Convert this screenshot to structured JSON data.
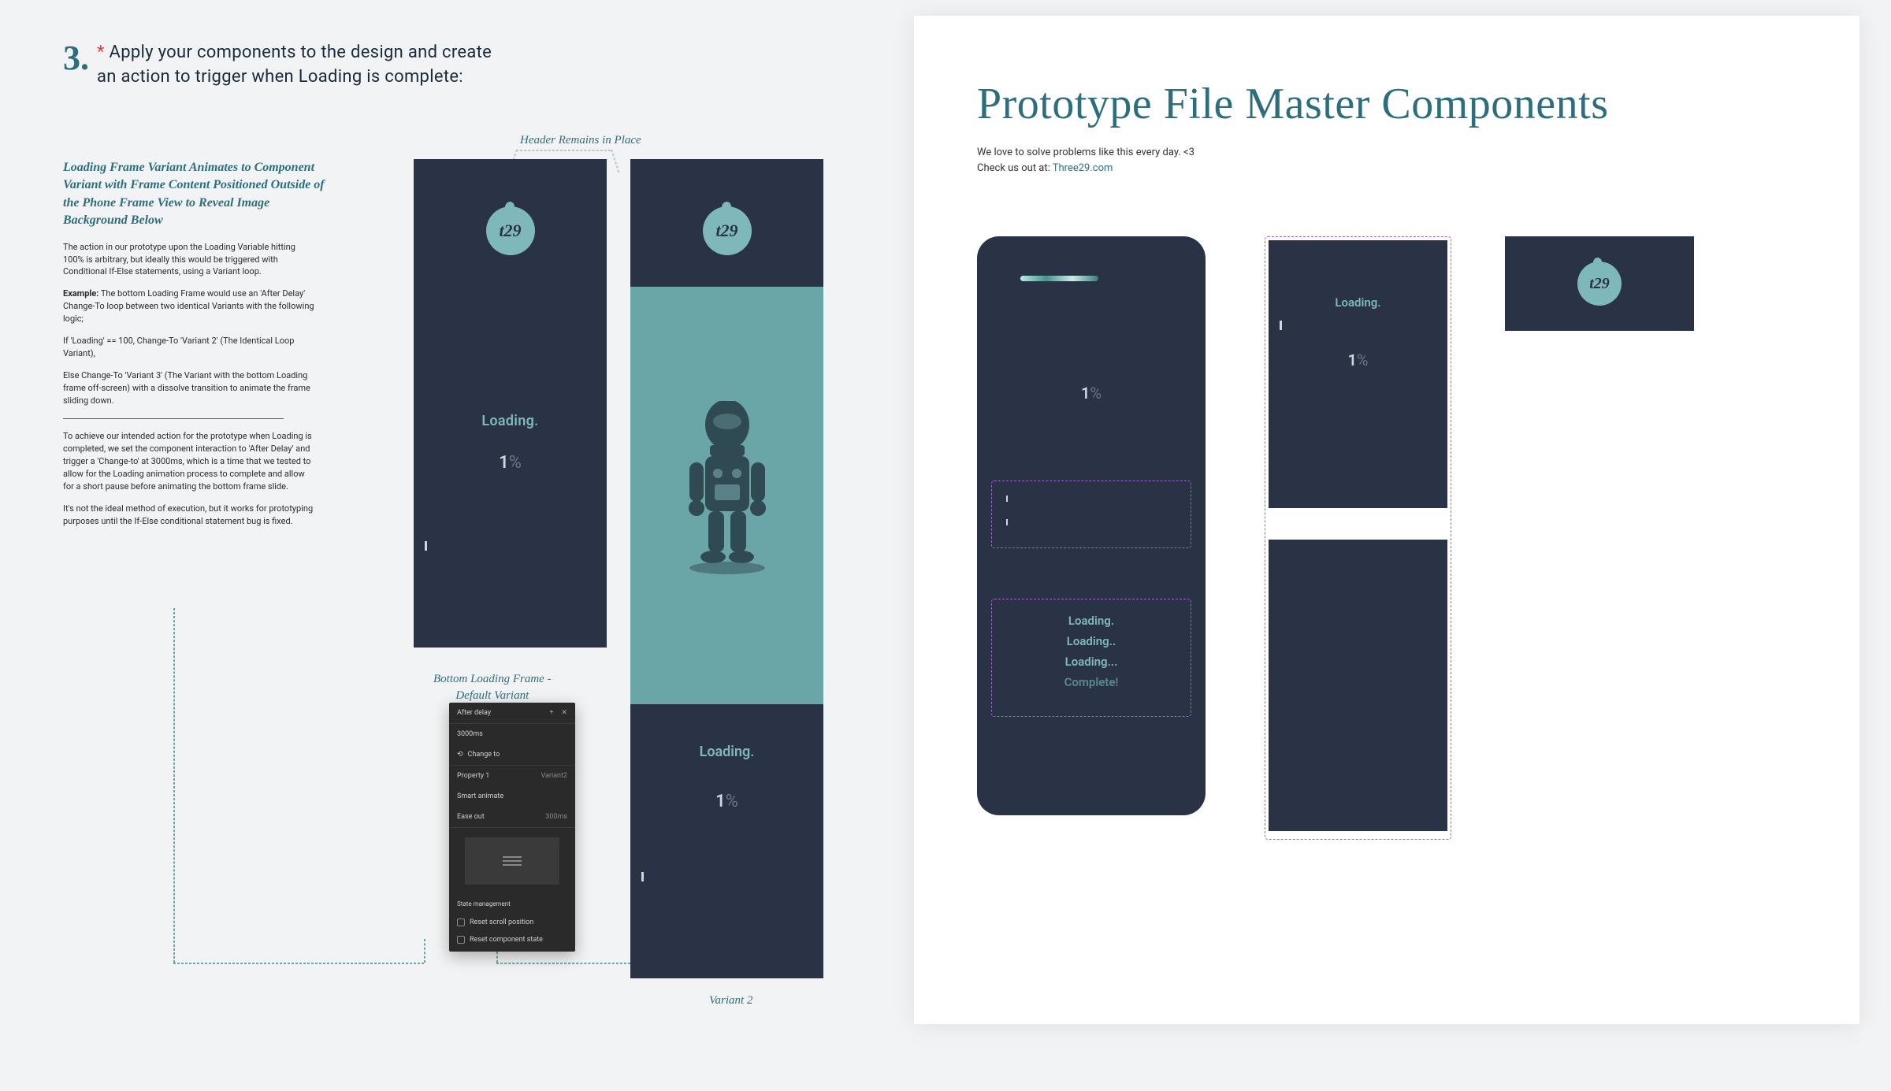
{
  "left": {
    "step_number": "3.",
    "asterisk": "*",
    "step_text_line1": "Apply your components to the design and create",
    "step_text_line2": "an action to trigger when Loading is complete:",
    "anno_title": "Loading Frame Variant Animates to Component Variant with Frame Content Positioned Outside of the Phone Frame View to Reveal Image Background Below",
    "anno_p1": "The action in our prototype upon the Loading Variable hitting 100% is arbitrary, but ideally this would be triggered with Conditional If-Else statements, using a Variant loop.",
    "anno_p2_label": "Example:",
    "anno_p2_rest": " The bottom Loading Frame would use an 'After Delay' Change-To loop between two identical Variants with the following logic;",
    "anno_p3": "If 'Loading' == 100, Change-To 'Variant 2' (The Identical Loop Variant),",
    "anno_p4": "Else Change-To 'Variant 3' (The Variant with the bottom Loading frame off-screen) with a dissolve transition to animate the frame sliding down.",
    "anno_p5": "To achieve our intended action for the prototype when Loading is completed, we set the component interaction to 'After Delay' and trigger a 'Change-to' at 3000ms, which is a time that we tested to allow for the Loading animation process to complete and allow for a short pause before animating the bottom frame slide.",
    "anno_p6": "It's not the ideal method of execution, but it works for prototyping purposes until the If-Else conditional statement bug is fixed.",
    "header_remains": "Header Remains in Place",
    "bottom_frame_label_l1": "Bottom Loading Frame -",
    "bottom_frame_label_l2": "Default Variant",
    "variant2_label": "Variant 2",
    "logo_text": "t29",
    "loading_label": "Loading.",
    "percent_value": "1",
    "percent_symbol": "%"
  },
  "panel": {
    "trigger_label": "After delay",
    "duration": "3000ms",
    "action_label": "Change to",
    "prop_label": "Property 1",
    "variant_val": "Variant2",
    "anim_label": "Smart animate",
    "easing": "Ease out",
    "easing_dur": "300ms",
    "state_header": "State management",
    "reset_scroll": "Reset scroll position",
    "reset_component": "Reset component state"
  },
  "right": {
    "title": "Prototype File Master Components",
    "sub_line1": "We love to solve problems like this every day. <3",
    "sub_line2_pre": "Check us out at: ",
    "sub_link": "Three29.com",
    "percent_value": "1",
    "percent_symbol": "%",
    "loading1": "Loading.",
    "loading2": "Loading..",
    "loading3": "Loading...",
    "complete": "Complete!",
    "logo_text": "t29"
  }
}
